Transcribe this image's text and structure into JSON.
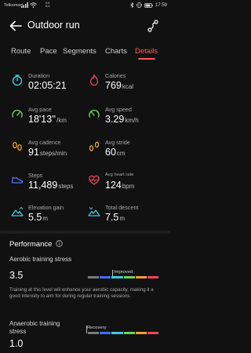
{
  "status_bar": {
    "carrier": "Telkomsel",
    "net_speed_value": "0.5",
    "net_speed_unit": "K/s",
    "time": "17:59"
  },
  "header": {
    "title": "Outdoor run"
  },
  "tabs": [
    {
      "label": "Route",
      "active": false
    },
    {
      "label": "Pace",
      "active": false
    },
    {
      "label": "Segments",
      "active": false
    },
    {
      "label": "Charts",
      "active": false
    },
    {
      "label": "Details",
      "active": true
    }
  ],
  "metrics": [
    {
      "label": "Duration",
      "value": "02:05:21",
      "unit": "",
      "icon": "stopwatch-icon",
      "color": "#41c8d6"
    },
    {
      "label": "Calories",
      "value": "769",
      "unit": "kcal",
      "icon": "flame-icon",
      "color": "#f0465a"
    },
    {
      "label": "Avg pace",
      "value": "18'13''",
      "unit": "/km",
      "icon": "pace-gauge-icon",
      "color": "#6bd35a"
    },
    {
      "label": "Avg speed",
      "value": "3.29",
      "unit": "km/h",
      "icon": "speed-gauge-icon",
      "color": "#6bd35a"
    },
    {
      "label": "Avg cadence",
      "value": "91",
      "unit": "steps/min",
      "icon": "footprints-icon",
      "color": "#f0a030"
    },
    {
      "label": "Avg stride",
      "value": "60",
      "unit": "cm",
      "icon": "stride-icon",
      "color": "#f0a030"
    },
    {
      "label": "Steps",
      "value": "11,489",
      "unit": "steps",
      "icon": "shoe-icon",
      "color": "#4f7cf5"
    },
    {
      "label": "Avg heart rate",
      "value": "124",
      "unit": "bpm",
      "icon": "heart-pulse-icon",
      "color": "#f0465a"
    },
    {
      "label": "Elevation gain",
      "value": "5.5",
      "unit": "m",
      "icon": "mountain-up-icon",
      "color": "#41c8d6"
    },
    {
      "label": "Total descent",
      "value": "7.5",
      "unit": "m",
      "icon": "mountain-down-icon",
      "color": "#41c8d6"
    }
  ],
  "performance": {
    "title": "Performance",
    "aerobic": {
      "label": "Aerobic training stress",
      "value": "3.5",
      "level": "Improved",
      "description": "Training at this level will enhance your aerobic capacity, making it a good intensity to aim for during regular training sessions."
    },
    "anaerobic": {
      "label": "Anaerobic training stress",
      "value": "1.0",
      "level": "Recovery"
    },
    "bar_colors": [
      "#7a7a7a",
      "#3f6ff0",
      "#41c8d6",
      "#6bd35a",
      "#f0a030",
      "#f0465a"
    ]
  }
}
